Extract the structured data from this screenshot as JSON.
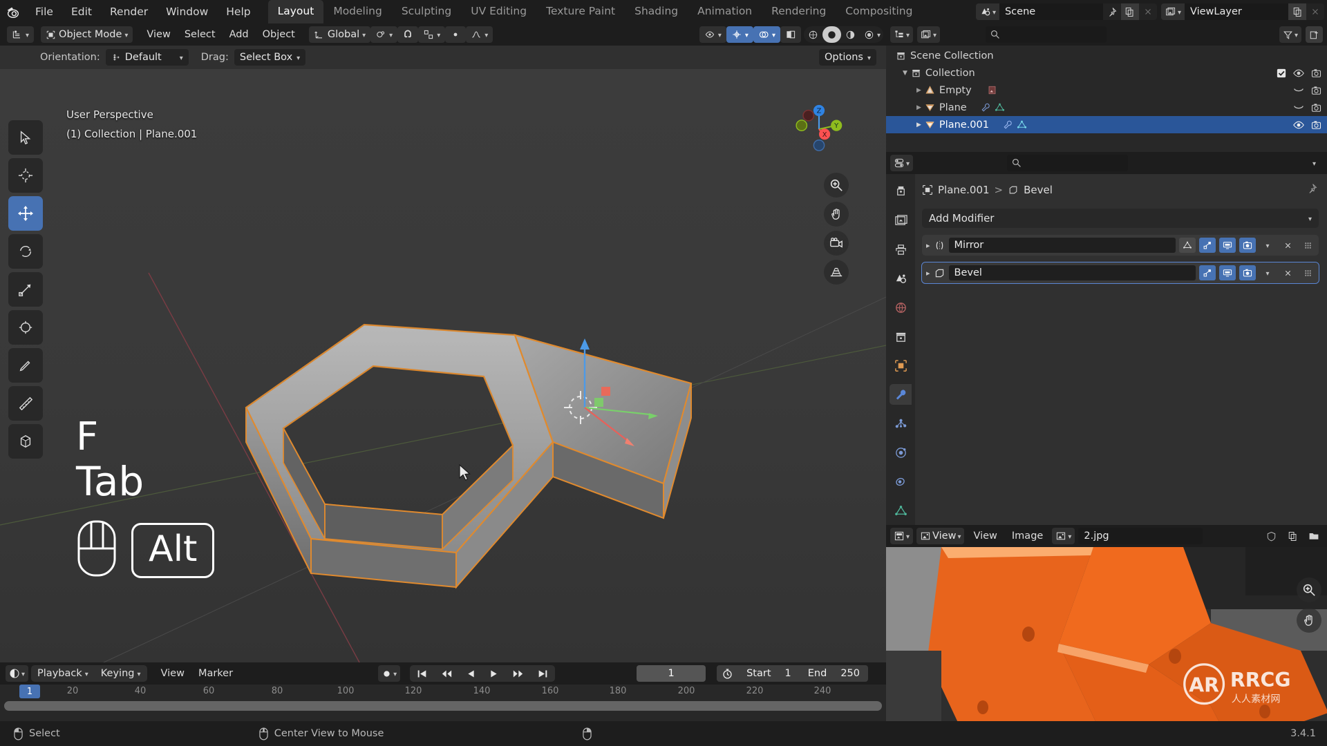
{
  "app": {
    "version": "3.4.1",
    "accent_blue": "#4772b3",
    "select_orange": "#ed9e5c",
    "header_dark": "#1d1d1d",
    "panel_gray": "#303030",
    "viewport_bg": "#393939"
  },
  "topbar": {
    "logo_icon": "blender-logo-icon",
    "menus": [
      "File",
      "Edit",
      "Render",
      "Window",
      "Help"
    ],
    "workspaces": [
      {
        "label": "Layout",
        "active": true
      },
      {
        "label": "Modeling",
        "active": false
      },
      {
        "label": "Sculpting",
        "active": false
      },
      {
        "label": "UV Editing",
        "active": false
      },
      {
        "label": "Texture Paint",
        "active": false
      },
      {
        "label": "Shading",
        "active": false
      },
      {
        "label": "Animation",
        "active": false
      },
      {
        "label": "Rendering",
        "active": false
      },
      {
        "label": "Compositing",
        "active": false
      }
    ],
    "scene": {
      "icon": "scene-icon",
      "name": "Scene",
      "pin_icon": "pin-icon",
      "new_icon": "duplicate-icon",
      "unlink_icon": "close-x-icon"
    },
    "viewlayer": {
      "icon": "render-layers-icon",
      "name": "ViewLayer",
      "new_icon": "duplicate-icon",
      "remove_icon": "close-x-icon"
    }
  },
  "viewport": {
    "header": {
      "editor_type_icon": "editor-type-3dview-icon",
      "mode_icon": "object-mode-icon",
      "mode": "Object Mode",
      "menus": [
        "View",
        "Select",
        "Add",
        "Object"
      ],
      "transform_orientation_icon": "orientation-global-icon",
      "transform_orientation": "Global",
      "snap_pivot_icon": "pivot-point-icon",
      "snap_magnet_icon": "snap-magnet-icon",
      "snap_target_icon": "snap-increment-icon",
      "proportional_icon": "proportional-edit-icon",
      "proportional_falloff_icon": "falloff-smooth-icon",
      "visibility_icon": "show-gizmo-icon",
      "gizmo_icon": "gizmo-icon",
      "overlays_icon": "overlays-icon",
      "xray_icon": "xray-toggle-icon",
      "shading_wireframe_icon": "shading-wireframe-icon",
      "shading_solid_icon": "shading-solid-icon",
      "shading_material_icon": "shading-material-icon",
      "shading_rendered_icon": "shading-rendered-icon"
    },
    "subheader": {
      "orientation_label": "Orientation:",
      "orientation_icon": "orientation-default-icon",
      "orientation_value": "Default",
      "drag_label": "Drag:",
      "drag_value": "Select Box",
      "options_label": "Options"
    },
    "info": {
      "line1": "User Perspective",
      "line2": "(1) Collection | Plane.001"
    },
    "tools": [
      {
        "name": "tweak-tool",
        "icon": "cursor-select-icon",
        "active": false
      },
      {
        "name": "cursor-tool",
        "icon": "3d-cursor-icon",
        "active": false
      },
      {
        "name": "move-tool",
        "icon": "move-arrows-icon",
        "active": true
      },
      {
        "name": "rotate-tool",
        "icon": "rotate-icon",
        "active": false
      },
      {
        "name": "scale-tool",
        "icon": "scale-icon",
        "active": false
      },
      {
        "name": "transform-tool",
        "icon": "transform-icon",
        "active": false
      },
      {
        "name": "annotate-tool",
        "icon": "annotate-pencil-icon",
        "active": false
      },
      {
        "name": "measure-tool",
        "icon": "measure-ruler-icon",
        "active": false
      },
      {
        "name": "add-cube-tool",
        "icon": "add-cube-icon",
        "active": false
      }
    ],
    "overlay_keys": {
      "key1": "F",
      "key2": "Tab",
      "mouse_icon": "mouse-middle-icon",
      "modifier": "Alt"
    },
    "gizmo_axes": [
      {
        "label": "Z",
        "color": "#2f83e3"
      },
      {
        "label": "Y",
        "color": "#8fbc1e"
      },
      {
        "label": "X",
        "color": "#fc5151"
      }
    ],
    "side_buttons": [
      {
        "name": "zoom-view-button",
        "icon": "zoom-magnifier-icon"
      },
      {
        "name": "pan-view-button",
        "icon": "hand-pan-icon"
      },
      {
        "name": "camera-view-button",
        "icon": "camera-icon"
      },
      {
        "name": "toggle-perspective-button",
        "icon": "grid-perspective-icon"
      }
    ]
  },
  "outliner": {
    "display_mode_icon": "outliner-display-mode-icon",
    "filter_id_icon": "outliner-id-filter-icon",
    "search_placeholder": "",
    "search_icon": "search-icon",
    "filter_icon": "filter-funnel-icon",
    "new_collection_icon": "new-collection-icon",
    "rows": [
      {
        "label": "Scene Collection",
        "icon": "collection-icon",
        "indent": 0,
        "selected": false,
        "expand": "none",
        "badges": [],
        "right": []
      },
      {
        "label": "Collection",
        "icon": "collection-icon",
        "indent": 1,
        "selected": false,
        "expand": "open",
        "badges": [],
        "right": [
          "checkbox-checked-icon",
          "eye-icon",
          "camera-icon"
        ]
      },
      {
        "label": "Empty",
        "icon": "empty-axes-icon",
        "indent": 2,
        "selected": false,
        "expand": "closed",
        "badges": [
          "image-empty-icon"
        ],
        "right": [
          "eye-closed-icon",
          "camera-icon"
        ]
      },
      {
        "label": "Plane",
        "icon": "mesh-data-icon",
        "indent": 2,
        "selected": false,
        "expand": "closed",
        "badges": [
          "modifier-wrench-icon",
          "mesh-triangle-icon"
        ],
        "right": [
          "eye-closed-icon",
          "camera-icon"
        ]
      },
      {
        "label": "Plane.001",
        "icon": "mesh-data-icon",
        "indent": 2,
        "selected": true,
        "expand": "closed",
        "badges": [
          "modifier-wrench-icon",
          "mesh-triangle-icon"
        ],
        "right": [
          "eye-icon",
          "camera-icon"
        ]
      }
    ]
  },
  "properties": {
    "editor_icon": "properties-editor-icon",
    "search_icon": "search-icon",
    "search_placeholder": "",
    "options_chevron_icon": "chevron-down-icon",
    "tabs": [
      {
        "name": "tool-tab",
        "icon": "tool-screwdriver-icon",
        "active": false
      },
      {
        "name": "render-tab",
        "icon": "render-camera-back-icon",
        "active": false
      },
      {
        "name": "output-tab",
        "icon": "output-printer-icon",
        "active": false
      },
      {
        "name": "view-layer-tab",
        "icon": "view-layer-images-icon",
        "active": false
      },
      {
        "name": "scene-tab",
        "icon": "scene-cone-icon",
        "active": false
      },
      {
        "name": "world-tab",
        "icon": "world-globe-icon",
        "active": false
      },
      {
        "name": "collection-tab",
        "icon": "collection-box-icon",
        "active": false
      },
      {
        "name": "object-tab",
        "icon": "object-square-icon",
        "active": false
      },
      {
        "name": "modifier-tab",
        "icon": "wrench-icon",
        "active": true
      },
      {
        "name": "particles-tab",
        "icon": "particles-icon",
        "active": false
      },
      {
        "name": "physics-tab",
        "icon": "physics-orbit-icon",
        "active": false
      },
      {
        "name": "constraints-tab",
        "icon": "constraints-icon",
        "active": false
      },
      {
        "name": "data-tab",
        "icon": "mesh-data-triangle-icon",
        "active": false
      }
    ],
    "breadcrumb": {
      "object_icon": "object-square-icon",
      "object": "Plane.001",
      "separator": ">",
      "modifier_icon": "bevel-icon",
      "modifier": "Bevel",
      "pin_icon": "pin-icon"
    },
    "add_modifier_label": "Add Modifier",
    "modifiers": [
      {
        "name": "Mirror",
        "icon": "mirror-icon",
        "expand_icon": "chevron-right-icon",
        "selected": false,
        "toggles": [
          {
            "name": "on-cage-toggle",
            "icon": "mesh-cage-icon",
            "on": false
          },
          {
            "name": "edit-mode-toggle",
            "icon": "edit-mode-icon",
            "on": true
          },
          {
            "name": "realtime-toggle",
            "icon": "display-monitor-icon",
            "on": true
          },
          {
            "name": "render-toggle",
            "icon": "camera-icon",
            "on": true
          }
        ],
        "dropdown_icon": "chevron-down-icon",
        "close_icon": "close-x-icon",
        "grip_icon": "drag-grip-icon"
      },
      {
        "name": "Bevel",
        "icon": "bevel-icon",
        "expand_icon": "chevron-right-icon",
        "selected": true,
        "toggles": [
          {
            "name": "edit-mode-toggle",
            "icon": "edit-mode-icon",
            "on": true
          },
          {
            "name": "realtime-toggle",
            "icon": "display-monitor-icon",
            "on": true
          },
          {
            "name": "render-toggle",
            "icon": "camera-icon",
            "on": true
          }
        ],
        "dropdown_icon": "chevron-down-icon",
        "close_icon": "close-x-icon",
        "grip_icon": "drag-grip-icon"
      }
    ]
  },
  "image_editor": {
    "editor_type_icon": "editor-type-image-icon",
    "mode_icon": "image-view-icon",
    "mode": "View",
    "menus": [
      "View",
      "Image"
    ],
    "browse_icon": "browse-image-icon",
    "image_name": "2.jpg",
    "fake_user_icon": "shield-fake-user-icon",
    "new_icon": "duplicate-icon",
    "open_icon": "folder-open-icon",
    "side_buttons": [
      {
        "name": "zoom-image-button",
        "icon": "zoom-magnifier-icon"
      },
      {
        "name": "pan-image-button",
        "icon": "hand-pan-icon"
      }
    ],
    "watermark": "RRCG"
  },
  "timeline": {
    "editor_type_icon": "editor-type-timeline-icon",
    "menus": [
      "Playback",
      "Keying",
      "View",
      "Marker"
    ],
    "record_icon": "record-dot-icon",
    "transport": [
      {
        "name": "jump-start-button",
        "icon": "jump-to-start-icon"
      },
      {
        "name": "prev-keyframe-button",
        "icon": "prev-keyframe-icon"
      },
      {
        "name": "play-reverse-button",
        "icon": "play-reverse-icon"
      },
      {
        "name": "play-button",
        "icon": "play-icon"
      },
      {
        "name": "next-keyframe-button",
        "icon": "next-keyframe-icon"
      },
      {
        "name": "jump-end-button",
        "icon": "jump-to-end-icon"
      }
    ],
    "current_frame": "1",
    "clock_icon": "stopwatch-icon",
    "start_label": "Start",
    "start_value": "1",
    "end_label": "End",
    "end_value": "250",
    "ticks": [
      "20",
      "40",
      "60",
      "80",
      "100",
      "120",
      "140",
      "160",
      "180",
      "200",
      "220",
      "240"
    ],
    "playhead_label": "1"
  },
  "statusbar": {
    "items": [
      {
        "icon": "mouse-left-icon",
        "label": "Select"
      },
      {
        "icon": "mouse-middle-icon",
        "label": "Center View to Mouse"
      },
      {
        "icon": "mouse-right-icon",
        "label": ""
      }
    ],
    "version": "3.4.1"
  }
}
